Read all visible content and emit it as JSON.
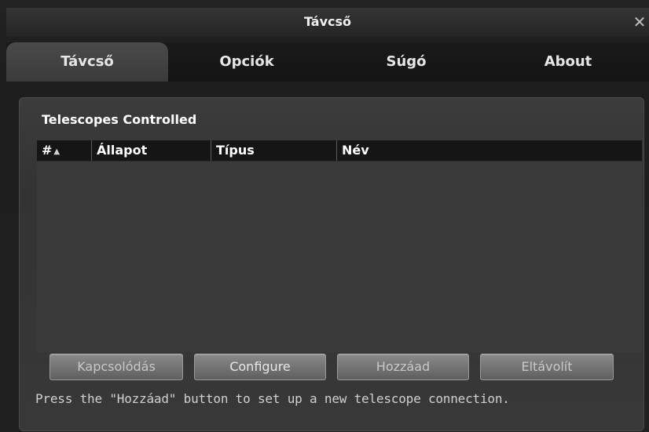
{
  "window": {
    "title": "Távcső",
    "close_icon": "close-icon"
  },
  "tabs": [
    {
      "label": "Távcső",
      "active": true
    },
    {
      "label": "Opciók",
      "active": false
    },
    {
      "label": "Súgó",
      "active": false
    },
    {
      "label": "About",
      "active": false
    }
  ],
  "panel": {
    "section_title": "Telescopes Controlled",
    "table": {
      "columns": [
        {
          "label": "#",
          "sort_icon": "sort-ascending-icon"
        },
        {
          "label": "Állapot"
        },
        {
          "label": "Típus"
        },
        {
          "label": "Név"
        }
      ],
      "rows": []
    },
    "buttons": {
      "connect": "Kapcsolódás",
      "configure": "Configure",
      "add": "Hozzáad",
      "remove": "Eltávolít"
    },
    "status_text": "Press the \"Hozzáad\" button to set up a new telescope connection."
  },
  "colors": {
    "background": "#1c1c1c",
    "panel": "#383838",
    "table_header": "#151515",
    "button": "#7a7a7a"
  }
}
